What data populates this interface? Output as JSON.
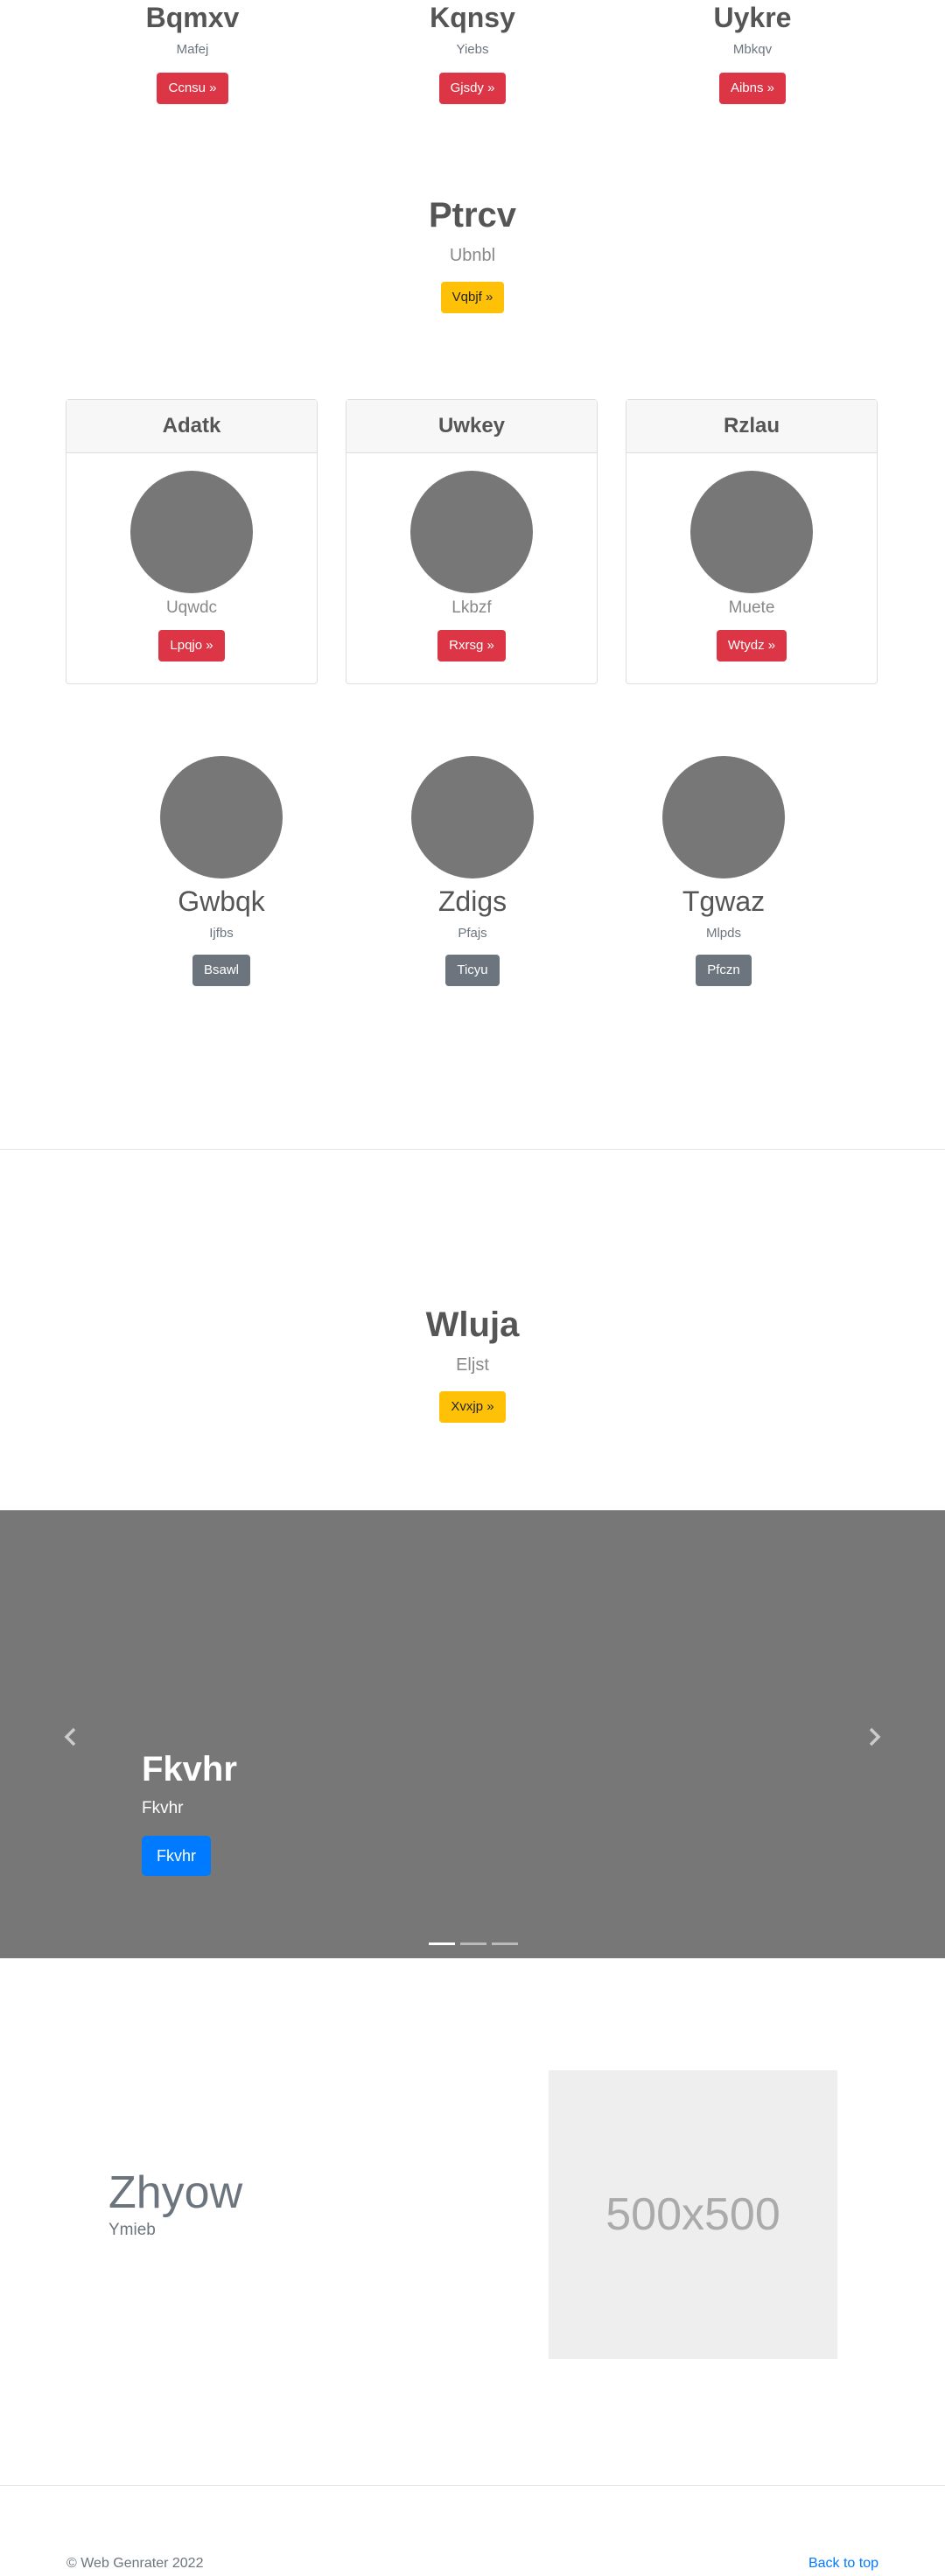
{
  "top_columns": [
    {
      "title": "Bqmxv",
      "subtitle": "Mafej",
      "button": "Ccnsu »"
    },
    {
      "title": "Kqnsy",
      "subtitle": "Yiebs",
      "button": "Gjsdy »"
    },
    {
      "title": "Uykre",
      "subtitle": "Mbkqv",
      "button": "Aibns »"
    }
  ],
  "hero1": {
    "title": "Ptrcv",
    "subtitle": "Ubnbl",
    "button": "Vqbjf »"
  },
  "cards": [
    {
      "header": "Adatk",
      "text": "Uqwdc",
      "button": "Lpqjo »"
    },
    {
      "header": "Uwkey",
      "text": "Lkbzf",
      "button": "Rxrsg »"
    },
    {
      "header": "Rzlau",
      "text": "Muete",
      "button": "Wtydz »"
    }
  ],
  "profiles": [
    {
      "name": "Gwbqk",
      "subtitle": "Ijfbs",
      "button": "Bsawl"
    },
    {
      "name": "Zdigs",
      "subtitle": "Pfajs",
      "button": "Ticyu"
    },
    {
      "name": "Tgwaz",
      "subtitle": "Mlpds",
      "button": "Pfczn"
    }
  ],
  "hero2": {
    "title": "Wluja",
    "subtitle": "Eljst",
    "button": "Xvxjp »"
  },
  "carousel": {
    "title": "Fkvhr",
    "subtitle": "Fkvhr",
    "button": "Fkvhr",
    "indicator_count": 3,
    "active_index": 0,
    "background": "#777777"
  },
  "feature": {
    "title": "Zhyow",
    "subtitle": "Ymieb",
    "placeholder_label": "500x500"
  },
  "footer": {
    "copyright": "© Web Genrater 2022",
    "back_to_top": "Back to top"
  },
  "colors": {
    "danger": "#dc3545",
    "warning": "#ffc107",
    "secondary": "#6c757d",
    "primary": "#007bff",
    "placeholder": "#777777"
  }
}
